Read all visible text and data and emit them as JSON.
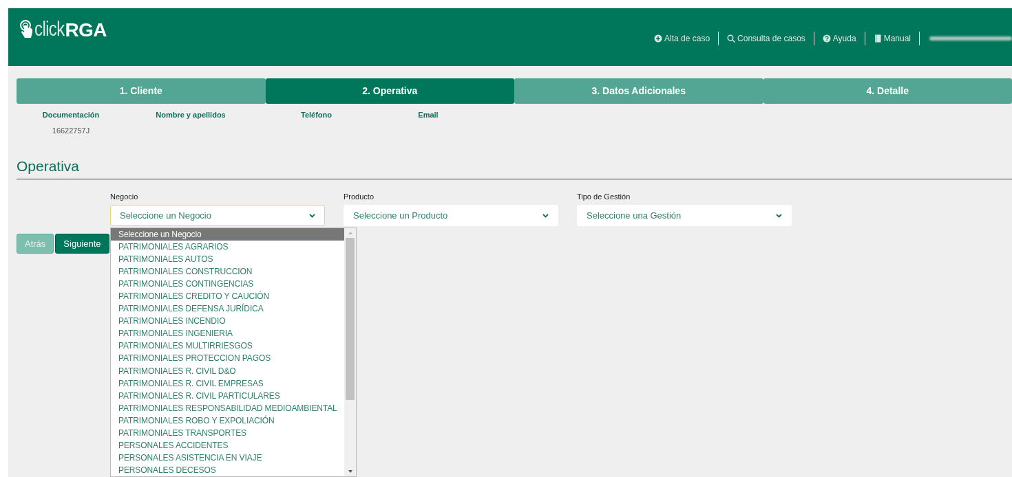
{
  "header": {
    "logo": {
      "light": "click",
      "bold": "RGA"
    },
    "nav": [
      {
        "label": "Alta de caso"
      },
      {
        "label": "Consulta de casos"
      },
      {
        "label": "Ayuda"
      },
      {
        "label": "Manual"
      }
    ]
  },
  "steps": [
    {
      "label": "1. Cliente",
      "selected": false
    },
    {
      "label": "2. Operativa",
      "selected": true
    },
    {
      "label": "3. Datos Adicionales",
      "selected": false
    },
    {
      "label": "4. Detalle",
      "selected": false
    }
  ],
  "client_info": [
    {
      "label": "Documentación",
      "value": "16622757J"
    },
    {
      "label": "Nombre y apellidos"
    },
    {
      "label": "Teléfono"
    },
    {
      "label": "Email"
    }
  ],
  "section_title": "Operativa",
  "fields": [
    {
      "label": "Negocio",
      "value": "Seleccione un Negocio",
      "focused": true
    },
    {
      "label": "Producto",
      "value": "Seleccione un Producto",
      "focused": false
    },
    {
      "label": "Tipo de Gestión",
      "value": "Seleccione una Gestión",
      "focused": false
    }
  ],
  "buttons": [
    {
      "label": "Atrás",
      "disabled": true
    },
    {
      "label": "Siguiente",
      "disabled": false
    }
  ],
  "dropdown": {
    "options": [
      {
        "label": "Seleccione un Negocio",
        "selected": true
      },
      {
        "label": "PATRIMONIALES AGRARIOS",
        "selected": false
      },
      {
        "label": "PATRIMONIALES AUTOS",
        "selected": false
      },
      {
        "label": "PATRIMONIALES CONSTRUCCION",
        "selected": false
      },
      {
        "label": "PATRIMONIALES CONTINGENCIAS",
        "selected": false
      },
      {
        "label": "PATRIMONIALES CREDITO Y CAUCIÓN",
        "selected": false
      },
      {
        "label": "PATRIMONIALES DEFENSA JURÍDICA",
        "selected": false
      },
      {
        "label": "PATRIMONIALES INCENDIO",
        "selected": false
      },
      {
        "label": "PATRIMONIALES INGENIERIA",
        "selected": false
      },
      {
        "label": "PATRIMONIALES MULTIRRIESGOS",
        "selected": false
      },
      {
        "label": "PATRIMONIALES PROTECCION PAGOS",
        "selected": false
      },
      {
        "label": "PATRIMONIALES R. CIVIL D&O",
        "selected": false
      },
      {
        "label": "PATRIMONIALES R. CIVIL EMPRESAS",
        "selected": false
      },
      {
        "label": "PATRIMONIALES R. CIVIL PARTICULARES",
        "selected": false
      },
      {
        "label": "PATRIMONIALES RESPONSABILIDAD MEDIOAMBIENTAL",
        "selected": false
      },
      {
        "label": "PATRIMONIALES ROBO Y EXPOLIACIÓN",
        "selected": false
      },
      {
        "label": "PATRIMONIALES TRANSPORTES",
        "selected": false
      },
      {
        "label": "PERSONALES ACCIDENTES",
        "selected": false
      },
      {
        "label": "PERSONALES ASISTENCIA EN VIAJE",
        "selected": false
      },
      {
        "label": "PERSONALES DECESOS",
        "selected": false
      }
    ]
  }
}
